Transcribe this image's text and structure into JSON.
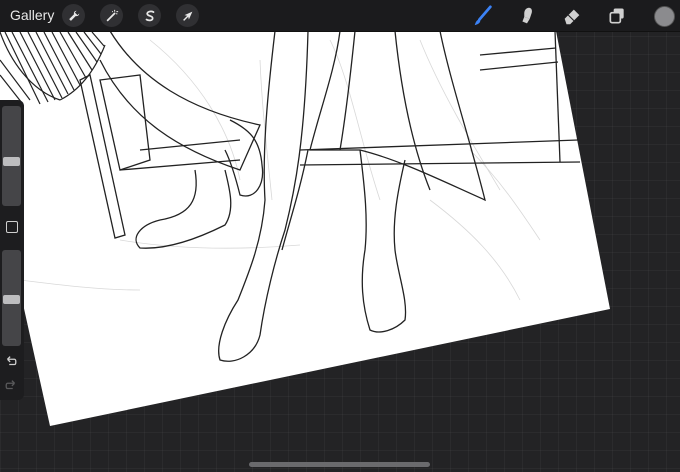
{
  "topbar": {
    "gallery_label": "Gallery",
    "left_tools": [
      {
        "icon": "wrench-icon",
        "action": "actions"
      },
      {
        "icon": "magic-wand-icon",
        "action": "adjustments"
      },
      {
        "icon": "selection-s-icon",
        "action": "selection"
      },
      {
        "icon": "arrow-cursor-icon",
        "action": "transform"
      }
    ],
    "right_tools": [
      {
        "icon": "brush-icon",
        "active": true
      },
      {
        "icon": "smudge-icon",
        "active": false
      },
      {
        "icon": "eraser-icon",
        "active": false
      },
      {
        "icon": "layers-icon",
        "active": false
      }
    ],
    "active_color": "#8b8b8e",
    "brush_color": "#3b82f6"
  },
  "sidebar": {
    "brush_size_level": 0.55,
    "opacity_level": 0.55
  },
  "colors": {
    "background": "#232325",
    "canvas": "#ffffff",
    "toolbar": "#1b1b1d"
  }
}
